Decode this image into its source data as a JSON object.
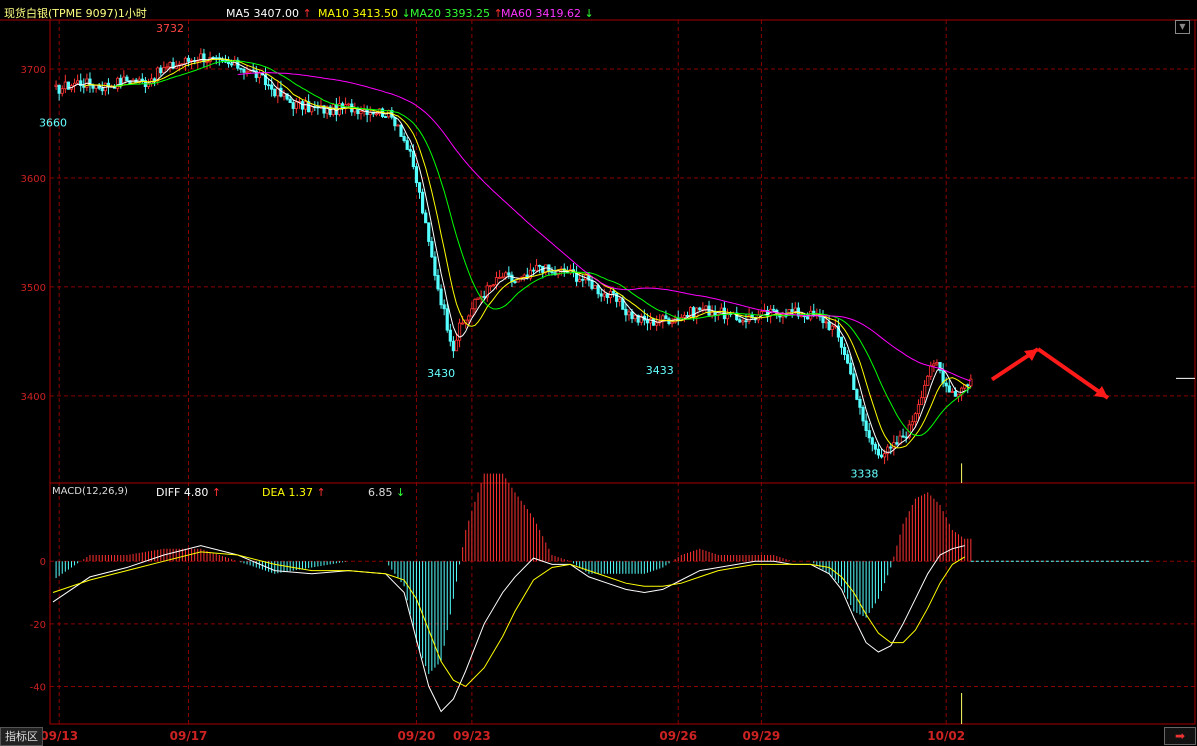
{
  "header": {
    "title": "现货白银(TPME 9097)1小时",
    "ma": [
      {
        "label": "MA5",
        "value": "3407.00",
        "arrow": "↑",
        "color": "#ffffff",
        "arrow_color": "#ff3333"
      },
      {
        "label": "MA10",
        "value": "3413.50",
        "arrow": "↓",
        "color": "#ffff00",
        "arrow_color": "#33ff33"
      },
      {
        "label": "MA20",
        "value": "3393.25",
        "arrow": "↑",
        "color": "#33ff33",
        "arrow_color": "#ff3333"
      },
      {
        "label": "MA60",
        "value": "3419.62",
        "arrow": "↓",
        "color": "#ff33ff",
        "arrow_color": "#33ff33"
      }
    ]
  },
  "macd_header": {
    "title": "MACD(12,26,9)",
    "diff_label": "DIFF",
    "diff_value": "4.80",
    "diff_arrow": "↑",
    "dea_label": "DEA",
    "dea_value": "1.37",
    "dea_arrow": "↑",
    "macd_value": "6.85",
    "macd_arrow": "↓"
  },
  "footer": {
    "tab_label": "指标区"
  },
  "colors": {
    "up": "#ff3232",
    "down": "#54ffff",
    "grid": "#8b0000",
    "ma5": "#ffffff",
    "ma10": "#ffff00",
    "ma20": "#00ff00",
    "ma60": "#ff00ff",
    "axis_text": "#cc2222"
  },
  "chart_data": [
    {
      "type": "candlestick",
      "y_ticks": [
        3400,
        3500,
        3600,
        3700
      ],
      "ylim": [
        3320,
        3745
      ],
      "x_labels": [
        "09/13",
        "09/17",
        "09/20",
        "09/23",
        "09/26",
        "09/29",
        "10/02"
      ],
      "price_path": [
        [
          0,
          3680
        ],
        [
          8,
          3688
        ],
        [
          16,
          3684
        ],
        [
          24,
          3690
        ],
        [
          30,
          3688
        ],
        [
          36,
          3700
        ],
        [
          42,
          3706
        ],
        [
          48,
          3712
        ],
        [
          54,
          3705
        ],
        [
          60,
          3703
        ],
        [
          66,
          3695
        ],
        [
          72,
          3680
        ],
        [
          78,
          3668
        ],
        [
          84,
          3664
        ],
        [
          90,
          3662
        ],
        [
          96,
          3665
        ],
        [
          102,
          3663
        ],
        [
          108,
          3660
        ],
        [
          112,
          3650
        ],
        [
          116,
          3620
        ],
        [
          119,
          3585
        ],
        [
          122,
          3540
        ],
        [
          125,
          3500
        ],
        [
          128,
          3465
        ],
        [
          130,
          3445
        ],
        [
          132,
          3462
        ],
        [
          135,
          3475
        ],
        [
          138,
          3490
        ],
        [
          142,
          3500
        ],
        [
          146,
          3510
        ],
        [
          150,
          3505
        ],
        [
          154,
          3508
        ],
        [
          158,
          3520
        ],
        [
          162,
          3512
        ],
        [
          166,
          3515
        ],
        [
          170,
          3510
        ],
        [
          174,
          3505
        ],
        [
          178,
          3495
        ],
        [
          182,
          3490
        ],
        [
          186,
          3478
        ],
        [
          190,
          3470
        ],
        [
          194,
          3468
        ],
        [
          198,
          3470
        ],
        [
          202,
          3472
        ],
        [
          206,
          3475
        ],
        [
          210,
          3480
        ],
        [
          214,
          3478
        ],
        [
          218,
          3475
        ],
        [
          222,
          3470
        ],
        [
          226,
          3472
        ],
        [
          230,
          3474
        ],
        [
          234,
          3476
        ],
        [
          238,
          3478
        ],
        [
          242,
          3476
        ],
        [
          246,
          3474
        ],
        [
          250,
          3470
        ],
        [
          254,
          3460
        ],
        [
          257,
          3440
        ],
        [
          260,
          3410
        ],
        [
          263,
          3375
        ],
        [
          266,
          3355
        ],
        [
          269,
          3348
        ],
        [
          272,
          3350
        ],
        [
          275,
          3360
        ],
        [
          278,
          3370
        ],
        [
          281,
          3395
        ],
        [
          284,
          3420
        ],
        [
          287,
          3430
        ],
        [
          290,
          3410
        ],
        [
          293,
          3402
        ],
        [
          296,
          3410
        ],
        [
          298,
          3415
        ]
      ],
      "annotations": [
        {
          "text": "3732",
          "kind": "high",
          "bar": 38,
          "value": 3732
        },
        {
          "text": "3660",
          "kind": "low",
          "bar": 0,
          "value": 3660
        },
        {
          "text": "3430",
          "kind": "low",
          "bar": 126,
          "value": 3430
        },
        {
          "text": "3433",
          "kind": "low",
          "bar": 197,
          "value": 3433
        },
        {
          "text": "3338",
          "kind": "low",
          "bar": 268,
          "value": 3338
        }
      ],
      "forecast_arrows": [
        {
          "from_value": 3415,
          "to_value": 3443
        },
        {
          "from_value": 3443,
          "to_value": 3398
        }
      ]
    },
    {
      "type": "macd",
      "y_ticks": [
        0,
        -20,
        -40
      ],
      "ylim": [
        -52,
        25
      ],
      "diff_path": [
        [
          0,
          -13
        ],
        [
          12,
          -5
        ],
        [
          24,
          -2
        ],
        [
          36,
          2
        ],
        [
          48,
          5
        ],
        [
          60,
          2
        ],
        [
          72,
          -3
        ],
        [
          84,
          -4
        ],
        [
          96,
          -3
        ],
        [
          108,
          -4
        ],
        [
          114,
          -10
        ],
        [
          118,
          -25
        ],
        [
          122,
          -40
        ],
        [
          126,
          -48
        ],
        [
          130,
          -44
        ],
        [
          134,
          -35
        ],
        [
          140,
          -20
        ],
        [
          146,
          -10
        ],
        [
          150,
          -5
        ],
        [
          156,
          1
        ],
        [
          162,
          -1
        ],
        [
          168,
          -1
        ],
        [
          174,
          -5
        ],
        [
          180,
          -7
        ],
        [
          186,
          -9
        ],
        [
          192,
          -10
        ],
        [
          198,
          -9
        ],
        [
          204,
          -6
        ],
        [
          210,
          -3
        ],
        [
          216,
          -2
        ],
        [
          222,
          -1
        ],
        [
          228,
          0
        ],
        [
          234,
          0
        ],
        [
          240,
          -1
        ],
        [
          246,
          -1
        ],
        [
          252,
          -4
        ],
        [
          256,
          -9
        ],
        [
          260,
          -18
        ],
        [
          264,
          -26
        ],
        [
          268,
          -29
        ],
        [
          272,
          -27
        ],
        [
          276,
          -20
        ],
        [
          280,
          -12
        ],
        [
          284,
          -4
        ],
        [
          288,
          2
        ],
        [
          292,
          4
        ],
        [
          296,
          5
        ]
      ],
      "dea_path": [
        [
          0,
          -10
        ],
        [
          12,
          -6
        ],
        [
          24,
          -3
        ],
        [
          36,
          0
        ],
        [
          48,
          3
        ],
        [
          60,
          2
        ],
        [
          72,
          -1
        ],
        [
          84,
          -3
        ],
        [
          96,
          -3
        ],
        [
          108,
          -4
        ],
        [
          114,
          -6
        ],
        [
          118,
          -12
        ],
        [
          122,
          -22
        ],
        [
          126,
          -32
        ],
        [
          130,
          -38
        ],
        [
          134,
          -40
        ],
        [
          140,
          -34
        ],
        [
          146,
          -24
        ],
        [
          150,
          -16
        ],
        [
          156,
          -6
        ],
        [
          162,
          -2
        ],
        [
          168,
          -1
        ],
        [
          174,
          -3
        ],
        [
          180,
          -5
        ],
        [
          186,
          -7
        ],
        [
          192,
          -8
        ],
        [
          198,
          -8
        ],
        [
          204,
          -7
        ],
        [
          210,
          -5
        ],
        [
          216,
          -3
        ],
        [
          222,
          -2
        ],
        [
          228,
          -1
        ],
        [
          234,
          -1
        ],
        [
          240,
          -1
        ],
        [
          246,
          -1
        ],
        [
          252,
          -2
        ],
        [
          256,
          -5
        ],
        [
          260,
          -10
        ],
        [
          264,
          -17
        ],
        [
          268,
          -23
        ],
        [
          272,
          -26
        ],
        [
          276,
          -26
        ],
        [
          280,
          -22
        ],
        [
          284,
          -15
        ],
        [
          288,
          -7
        ],
        [
          292,
          -1
        ],
        [
          296,
          1.4
        ]
      ]
    }
  ]
}
